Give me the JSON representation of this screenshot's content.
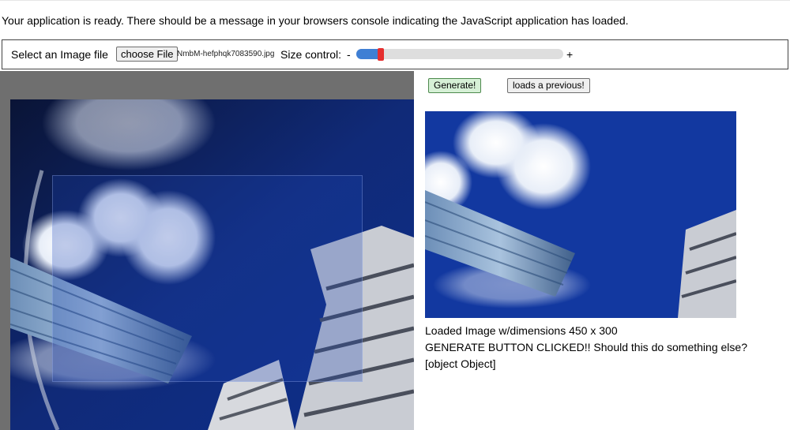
{
  "status_message": "Your application is ready. There should be a message in your browsers console indicating the JavaScript application has loaded.",
  "controls": {
    "select_label": "Select an Image file",
    "choose_button": "choose File",
    "file_name": "NmbM-hefphqk7083590.jpg",
    "size_label": "Size control:",
    "minus": "-",
    "plus": "+",
    "slider_value_fraction": 0.11,
    "slider_colors": {
      "fill": "#3f7fd4",
      "thumb": "#e52e2e",
      "track": "#dedede"
    }
  },
  "buttons": {
    "generate": "Generate!",
    "load_previous": "loads a previous!"
  },
  "preview": {
    "image_description_icon": "skyscraper-photo",
    "dimensions_text": "Loaded Image w/dimensions 450 x 300"
  },
  "log": [
    "GENERATE BUTTON CLICKED!! Should this do something else?",
    "[object Object]"
  ]
}
